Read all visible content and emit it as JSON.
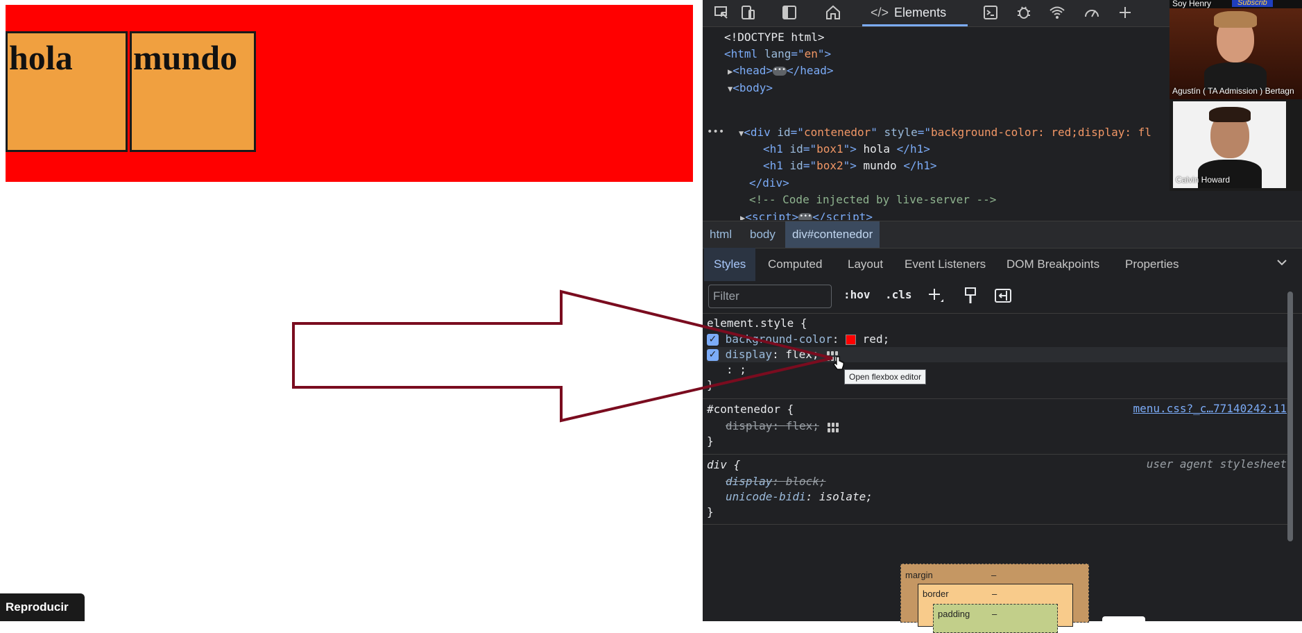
{
  "page": {
    "box1_text": "hola",
    "box2_text": "mundo",
    "play_label": "Reproducir"
  },
  "devtools": {
    "toolbar": {
      "active_tab": "Elements",
      "icons": [
        "inspect-icon",
        "device-icon",
        "dock-icon",
        "home-icon",
        "code-icon",
        "console-icon",
        "bug-icon",
        "network-icon",
        "performance-icon",
        "plus-icon"
      ]
    },
    "dom": {
      "doctype": "<!DOCTYPE html>",
      "html_lang": "en",
      "div_id": "contenedor",
      "div_style": "background-color: red;display: fl",
      "h1_1_id": "box1",
      "h1_1_text": " hola ",
      "h1_2_id": "box2",
      "h1_2_text": " mundo ",
      "comment": "<!-- Code injected by live-server -->"
    },
    "breadcrumb": [
      "html",
      "body",
      "div#contenedor"
    ],
    "styles_tabs": [
      "Styles",
      "Computed",
      "Layout",
      "Event Listeners",
      "DOM Breakpoints",
      "Properties"
    ],
    "filter_placeholder": "Filter",
    "filter_buttons": {
      "hov": ":hov",
      "cls": ".cls"
    },
    "rules": {
      "element_style": {
        "selector": "element.style {",
        "bg_prop": "background-color",
        "bg_value": "red",
        "display_prop": "display",
        "display_value": "flex"
      },
      "contenedor": {
        "selector": "#contenedor {",
        "prop": "display",
        "value": "flex",
        "source": "menu.css?_c…77140242:11"
      },
      "div": {
        "selector": "div {",
        "source": "user agent stylesheet",
        "prop1": "display",
        "val1": "block",
        "prop2": "unicode-bidi",
        "val2": "isolate"
      }
    },
    "tooltip": "Open flexbox editor",
    "box_model": {
      "margin": "margin",
      "border": "border",
      "padding": "padding",
      "dash": "–"
    }
  },
  "video": {
    "header": "Soy Henry",
    "badge": "Subscrib",
    "person1": "Agustín ( TA Admission ) Bertagn",
    "person2": "Calvin Howard"
  },
  "colors": {
    "container": "#ff0000",
    "box": "#f0a040",
    "arrow": "#7a0c1f",
    "accent": "#7cacf8"
  }
}
